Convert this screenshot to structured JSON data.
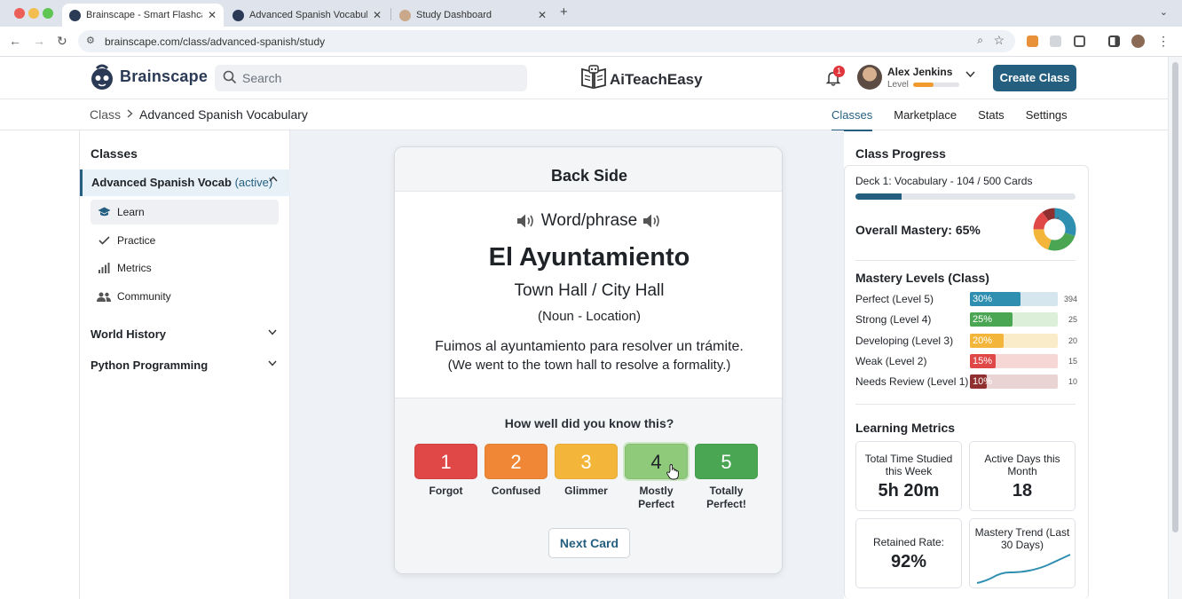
{
  "browser": {
    "tabs": [
      {
        "title": "Brainscape - Smart Flashcards",
        "active": true
      },
      {
        "title": "Advanced Spanish Vocabulary",
        "active": false
      },
      {
        "title": "Study Dashboard",
        "active": false
      }
    ],
    "url": "brainscape.com/class/advanced-spanish/study"
  },
  "header": {
    "brand": "Brainscape",
    "search_placeholder": "Search",
    "center_logo": "AiTeachEasy",
    "notifications": "1",
    "user_name": "Alex Jenkins",
    "user_level_label": "Level",
    "user_level_progress": 0.45,
    "create_button": "Create Class"
  },
  "breadcrumb": {
    "root": "Class",
    "current": "Advanced Spanish Vocabulary"
  },
  "topnav": [
    "Classes",
    "Marketplace",
    "Stats",
    "Settings"
  ],
  "sidebar": {
    "title": "Classes",
    "active_class": "Advanced Spanish Vocab",
    "active_state": "(active)",
    "items": [
      "Learn",
      "Practice",
      "Metrics",
      "Community"
    ],
    "groups": [
      "World History",
      "Python Programming"
    ]
  },
  "card": {
    "side": "Back Side",
    "type": "Word/phrase",
    "term": "El Ayuntamiento",
    "translation": "Town Hall / City Hall",
    "pos": "(Noun - Location)",
    "example_es": "Fuimos al ayuntamiento para resolver un trámite.",
    "example_en": "(We went to the town hall to resolve a formality.)",
    "question": "How well did you know this?",
    "ratings": [
      {
        "num": "1",
        "label": "Forgot",
        "color": "#e04747"
      },
      {
        "num": "2",
        "label": "Confused",
        "color": "#ef8736"
      },
      {
        "num": "3",
        "label": "Glimmer",
        "color": "#f4b63a"
      },
      {
        "num": "4",
        "label": "Mostly Perfect",
        "color": "#8fc97a"
      },
      {
        "num": "5",
        "label": "Totally Perfect!",
        "color": "#4aa653"
      }
    ],
    "next_button": "Next Card"
  },
  "progress": {
    "title": "Class Progress",
    "deck": "Deck 1: Vocabulary - 104 / 500 Cards",
    "deck_fraction": 0.208,
    "overall": "Overall Mastery: 65%",
    "donut": [
      {
        "value": 30,
        "color": "#2f8fb0"
      },
      {
        "value": 25,
        "color": "#4aa653"
      },
      {
        "value": 20,
        "color": "#f4b63a"
      },
      {
        "value": 15,
        "color": "#e04747"
      },
      {
        "value": 10,
        "color": "#8f2f2f"
      }
    ],
    "levels_title": "Mastery Levels (Class)",
    "levels": [
      {
        "label": "Perfect (Level 5)",
        "pct": "30%",
        "value": 30,
        "count": "394",
        "color": "#2f8fb0",
        "track": "#d5e6ef"
      },
      {
        "label": "Strong (Level 4)",
        "pct": "25%",
        "value": 25,
        "count": "25",
        "color": "#4aa653",
        "track": "#dcefd9"
      },
      {
        "label": "Developing (Level 3)",
        "pct": "20%",
        "value": 20,
        "count": "20",
        "color": "#f4b63a",
        "track": "#fbecc9"
      },
      {
        "label": "Weak (Level 2)",
        "pct": "15%",
        "value": 15,
        "count": "15",
        "color": "#e04747",
        "track": "#f7d6d6"
      },
      {
        "label": "Needs Review (Level 1)",
        "pct": "10%",
        "value": 10,
        "count": "10",
        "color": "#8f2f2f",
        "track": "#ead3d3"
      }
    ],
    "metrics_title": "Learning Metrics",
    "metrics": [
      {
        "label": "Total Time Studied this Week",
        "value": "5h 20m"
      },
      {
        "label": "Active Days this Month",
        "value": "18"
      },
      {
        "label": "Retained Rate:",
        "value": "92%"
      },
      {
        "label": "Mastery Trend (Last 30 Days)",
        "value": ""
      }
    ]
  }
}
